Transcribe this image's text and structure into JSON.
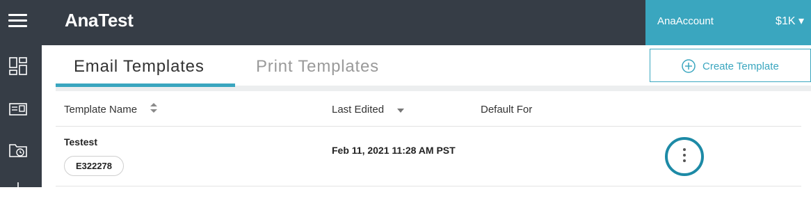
{
  "app": {
    "title": "AnaTest"
  },
  "account": {
    "name": "AnaAccount",
    "balance": "$1K ▾"
  },
  "sidebar": {
    "items": [
      {
        "icon": "menu-icon"
      },
      {
        "icon": "dashboard-icon"
      },
      {
        "icon": "card-icon"
      },
      {
        "icon": "history-folder-icon"
      }
    ]
  },
  "tabs": [
    {
      "label": "Email Templates",
      "active": true
    },
    {
      "label": "Print Templates",
      "active": false
    }
  ],
  "toolbar": {
    "create_label": "Create Template"
  },
  "table": {
    "columns": [
      "Template Name",
      "Last Edited",
      "Default For"
    ],
    "rows": [
      {
        "name": "Testest",
        "code": "E322278",
        "last_edited": "Feb 11, 2021 11:28 AM PST",
        "default_for": ""
      }
    ]
  },
  "colors": {
    "header_bg": "#363d46",
    "accent": "#3aa6bf",
    "kebab_ring": "#1d8aa6"
  }
}
